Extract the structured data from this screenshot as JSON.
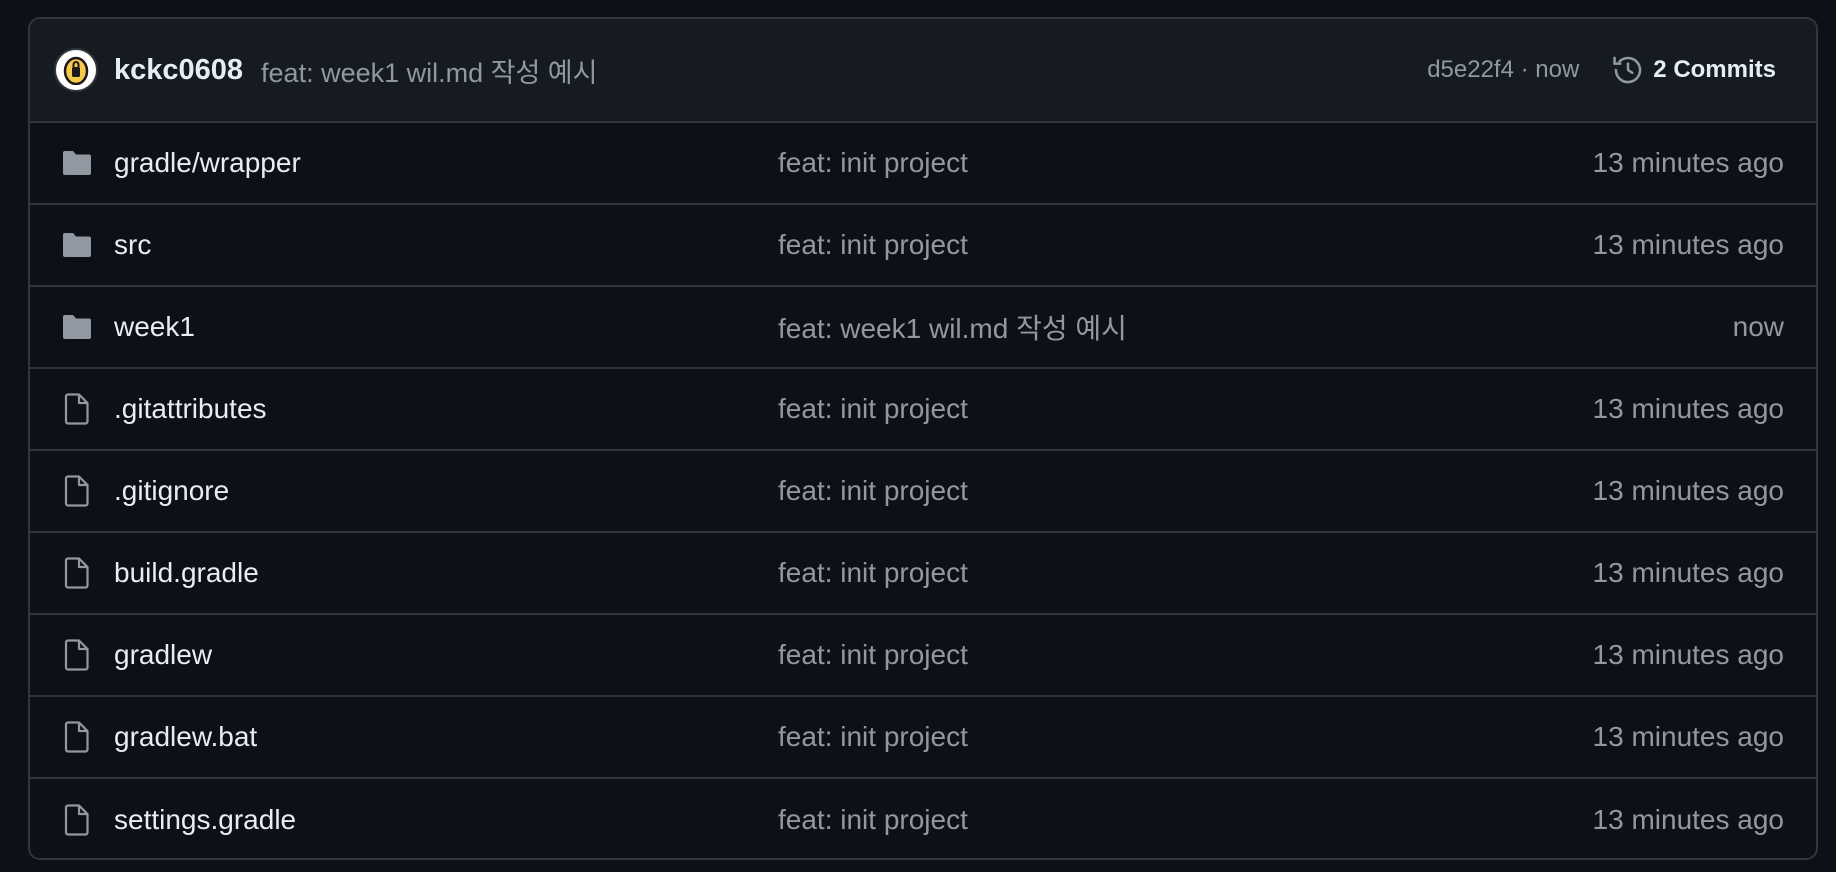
{
  "latest_commit": {
    "author": "kckc0608",
    "message": "feat: week1 wil.md 작성 예시",
    "sha_time": "d5e22f4 · now",
    "commits_label": "2 Commits"
  },
  "files": [
    {
      "type": "folder",
      "icon": "folder-icon",
      "name": "gradle/wrapper",
      "message": "feat: init project",
      "time": "13 minutes ago"
    },
    {
      "type": "folder",
      "icon": "folder-icon",
      "name": "src",
      "message": "feat: init project",
      "time": "13 minutes ago"
    },
    {
      "type": "folder",
      "icon": "folder-icon",
      "name": "week1",
      "message": "feat: week1 wil.md 작성 예시",
      "time": "now"
    },
    {
      "type": "file",
      "icon": "file-icon",
      "name": ".gitattributes",
      "message": "feat: init project",
      "time": "13 minutes ago"
    },
    {
      "type": "file",
      "icon": "file-icon",
      "name": ".gitignore",
      "message": "feat: init project",
      "time": "13 minutes ago"
    },
    {
      "type": "file",
      "icon": "file-icon",
      "name": "build.gradle",
      "message": "feat: init project",
      "time": "13 minutes ago"
    },
    {
      "type": "file",
      "icon": "file-icon",
      "name": "gradlew",
      "message": "feat: init project",
      "time": "13 minutes ago"
    },
    {
      "type": "file",
      "icon": "file-icon",
      "name": "gradlew.bat",
      "message": "feat: init project",
      "time": "13 minutes ago"
    },
    {
      "type": "file",
      "icon": "file-icon",
      "name": "settings.gradle",
      "message": "feat: init project",
      "time": "13 minutes ago"
    }
  ],
  "colors": {
    "background": "#0d1117",
    "header_bg": "#161b22",
    "border": "#30363d",
    "text_primary": "#e6edf3",
    "text_muted": "#9198a1",
    "folder_icon": "#9198a1"
  }
}
